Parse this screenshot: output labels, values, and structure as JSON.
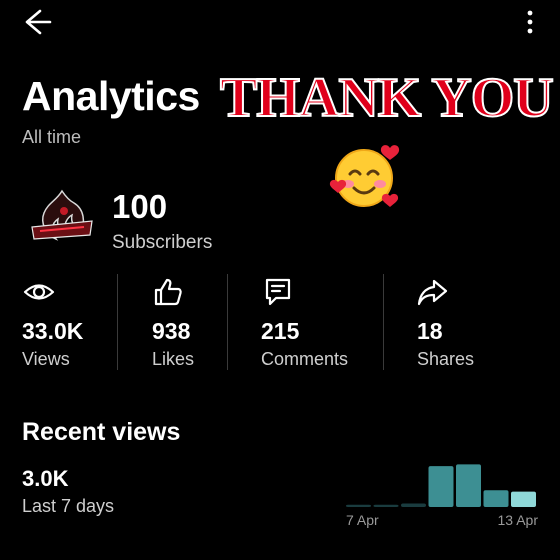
{
  "header": {
    "back_icon": "arrow-left-icon",
    "menu_icon": "more-vertical-icon"
  },
  "page": {
    "title": "Analytics",
    "range": "All time"
  },
  "overlay": {
    "text": "THANK YOU",
    "text_color": "#e0001b",
    "emoji": "smiling-face-with-hearts"
  },
  "channel": {
    "subscribers": "100",
    "subscribers_label": "Subscribers"
  },
  "stats": [
    {
      "icon": "eye-icon",
      "value": "33.0K",
      "label": "Views"
    },
    {
      "icon": "thumbs-up-icon",
      "value": "938",
      "label": "Likes"
    },
    {
      "icon": "comment-icon",
      "value": "215",
      "label": "Comments"
    },
    {
      "icon": "share-icon",
      "value": "18",
      "label": "Shares"
    }
  ],
  "recent": {
    "title": "Recent views",
    "value": "3.0K",
    "label": "Last 7 days"
  },
  "chart_data": {
    "type": "bar",
    "categories": [
      "",
      "",
      "",
      "",
      "",
      "",
      ""
    ],
    "values": [
      0.05,
      0.05,
      0.08,
      0.93,
      0.97,
      0.38,
      0.35
    ],
    "x_tick_labels": {
      "first": "7 Apr",
      "last": "13 Apr"
    },
    "bar_colors": [
      "#1a3c3f",
      "#1a3c3f",
      "#1a3c3f",
      "#3d8f93",
      "#3d8f93",
      "#3d8f93",
      "#8fd8d8"
    ],
    "ylim": [
      0,
      1
    ],
    "grid": false
  }
}
